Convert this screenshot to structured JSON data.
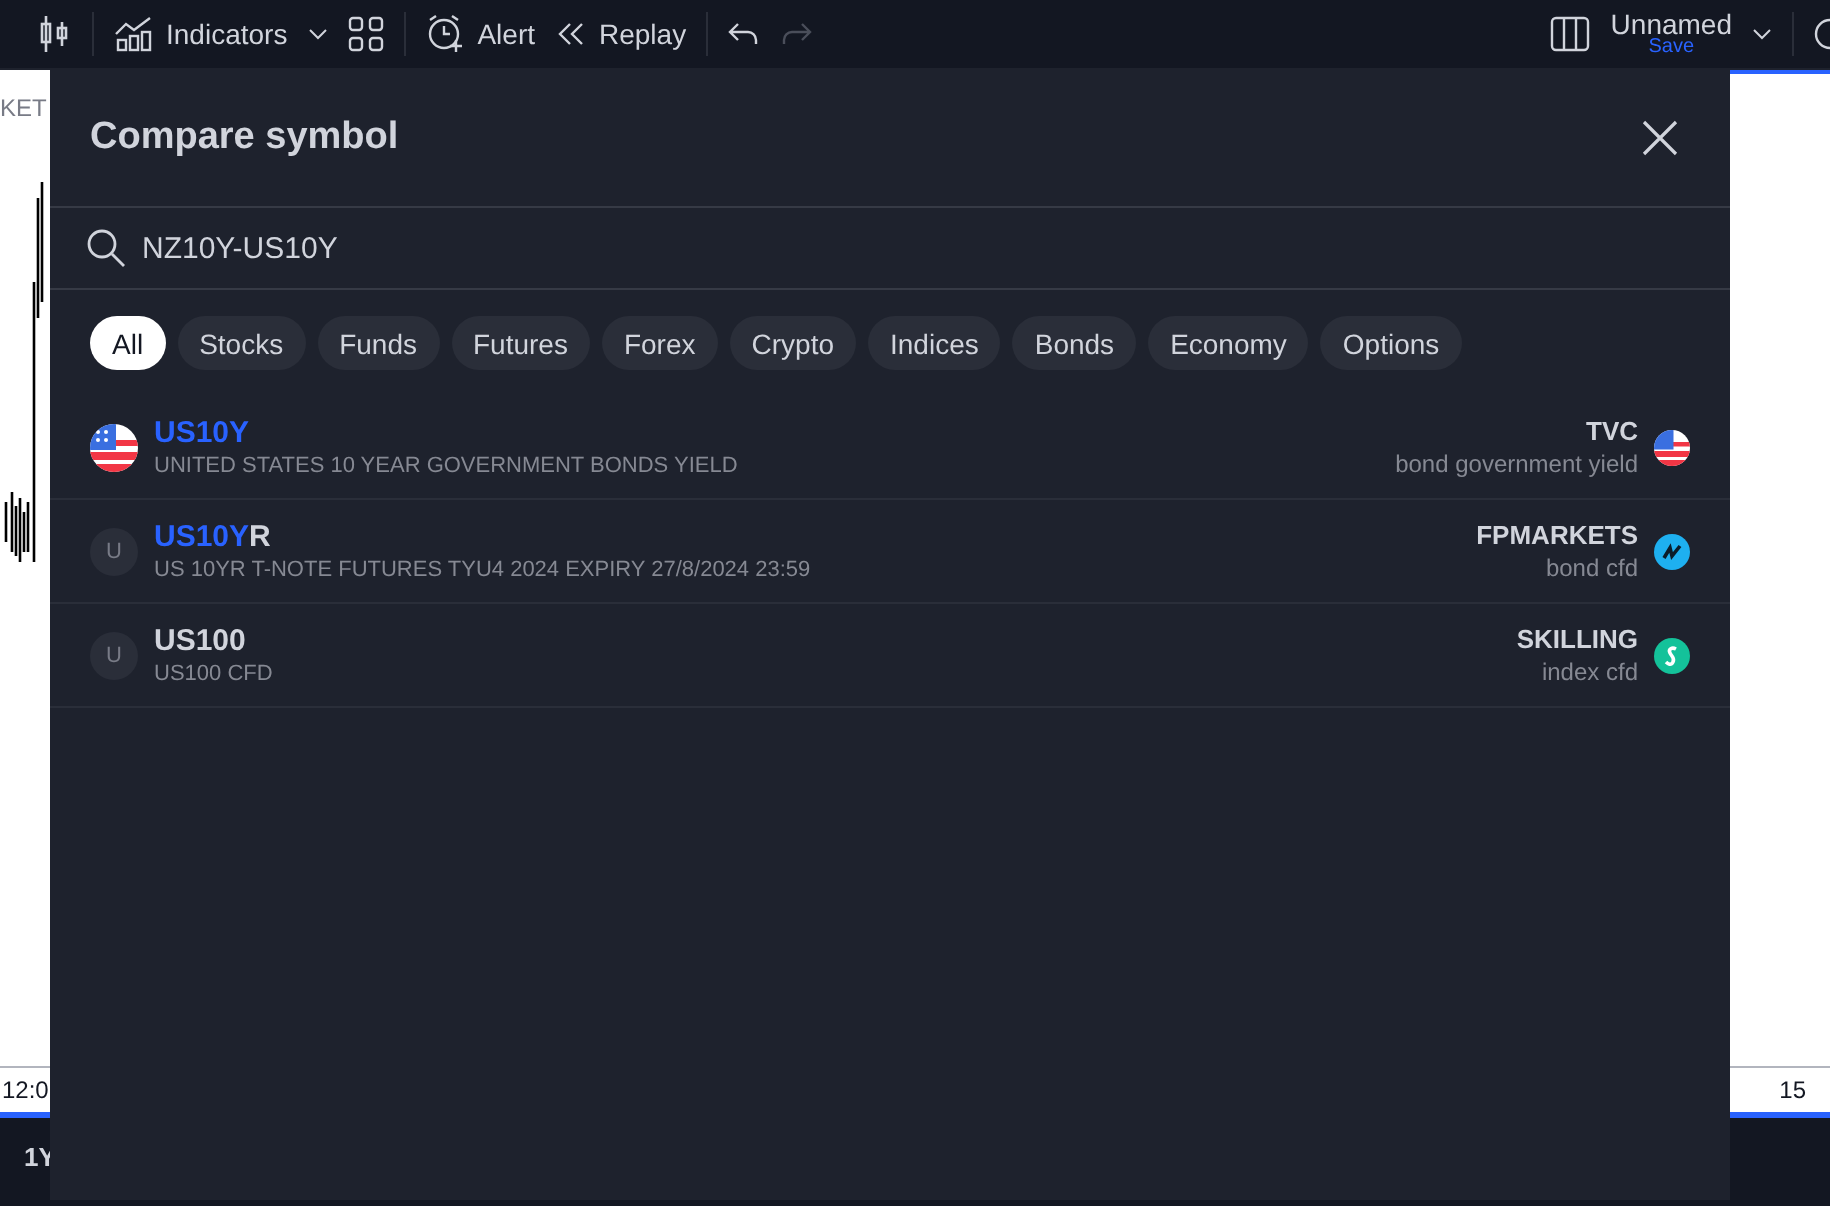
{
  "toolbar": {
    "indicators": "Indicators",
    "alert": "Alert",
    "replay": "Replay",
    "layout_name": "Unnamed",
    "save": "Save"
  },
  "chart": {
    "top_label": "KET",
    "time_label": "12:0",
    "right_label": "15",
    "range": "1Y"
  },
  "dialog": {
    "title": "Compare symbol",
    "search": {
      "value": "NZ10Y-US10Y"
    },
    "filters": [
      {
        "label": "All",
        "selected": true
      },
      {
        "label": "Stocks",
        "selected": false
      },
      {
        "label": "Funds",
        "selected": false
      },
      {
        "label": "Futures",
        "selected": false
      },
      {
        "label": "Forex",
        "selected": false
      },
      {
        "label": "Crypto",
        "selected": false
      },
      {
        "label": "Indices",
        "selected": false
      },
      {
        "label": "Bonds",
        "selected": false
      },
      {
        "label": "Economy",
        "selected": false
      },
      {
        "label": "Options",
        "selected": false
      }
    ],
    "results": [
      {
        "logo": {
          "kind": "flag"
        },
        "match": "US10Y",
        "description": "UNITED STATES 10 YEAR GOVERNMENT BONDS YIELD",
        "exchange": "TVC",
        "type": "bond government yield",
        "source_logo": {
          "kind": "flag"
        }
      },
      {
        "logo": {
          "kind": "letter",
          "letter": "U"
        },
        "match": "US10Y",
        "rest": "R",
        "description": "US 10YR T-NOTE FUTURES TYU4 2024 EXPIRY 27/8/2024 23:59",
        "exchange": "FPMARKETS",
        "type": "bond cfd",
        "source_logo": {
          "kind": "blue"
        }
      },
      {
        "logo": {
          "kind": "letter",
          "letter": "U"
        },
        "rest": "US100",
        "description": "US100 CFD",
        "exchange": "SKILLING",
        "type": "index cfd",
        "source_logo": {
          "kind": "green"
        }
      }
    ]
  }
}
